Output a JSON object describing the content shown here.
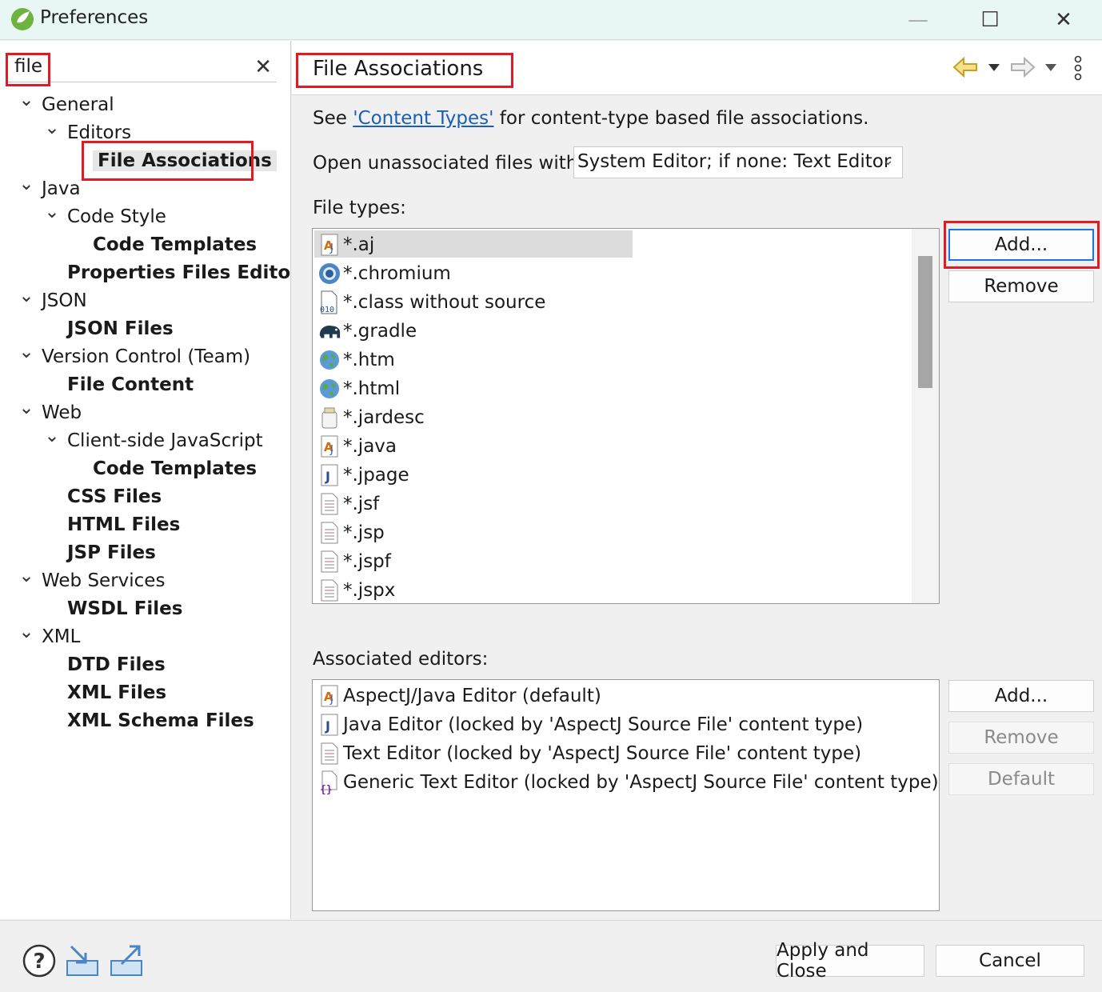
{
  "window": {
    "title": "Preferences",
    "minimize": "—",
    "maximize": "☐",
    "close": "✕"
  },
  "filter": {
    "value": "file",
    "clear_icon": "✕"
  },
  "tree": [
    {
      "label": "General",
      "chevron": "⌄"
    },
    {
      "label": "Editors",
      "chevron": "⌄"
    },
    {
      "label": "File Associations"
    },
    {
      "label": "Java",
      "chevron": "⌄"
    },
    {
      "label": "Code Style",
      "chevron": "⌄"
    },
    {
      "label": "Code Templates"
    },
    {
      "label": "Properties Files Editor"
    },
    {
      "label": "JSON",
      "chevron": "⌄"
    },
    {
      "label": "JSON Files"
    },
    {
      "label": "Version Control (Team)",
      "chevron": "⌄"
    },
    {
      "label": "File Content"
    },
    {
      "label": "Web",
      "chevron": "⌄"
    },
    {
      "label": "Client-side JavaScript",
      "chevron": "⌄"
    },
    {
      "label": "Code Templates"
    },
    {
      "label": "CSS Files"
    },
    {
      "label": "HTML Files"
    },
    {
      "label": "JSP Files"
    },
    {
      "label": "Web Services",
      "chevron": "⌄"
    },
    {
      "label": "WSDL Files"
    },
    {
      "label": "XML",
      "chevron": "⌄"
    },
    {
      "label": "DTD Files"
    },
    {
      "label": "XML Files"
    },
    {
      "label": "XML Schema Files"
    }
  ],
  "page": {
    "title": "File Associations",
    "desc_prefix": "See ",
    "desc_link": "'Content Types'",
    "desc_suffix": " for content-type based file associations.",
    "open_label": "Open unassociated files with:",
    "open_value": "System Editor; if none: Text Editor",
    "file_types_label": "File types:",
    "associated_label": "Associated editors:"
  },
  "file_types": [
    {
      "name": "*.aj",
      "icon": "aspectj-icon"
    },
    {
      "name": "*.chromium",
      "icon": "chromium-icon"
    },
    {
      "name": "*.class without source",
      "icon": "class-file-icon"
    },
    {
      "name": "*.gradle",
      "icon": "gradle-elephant-icon"
    },
    {
      "name": "*.htm",
      "icon": "globe-icon"
    },
    {
      "name": "*.html",
      "icon": "globe-icon"
    },
    {
      "name": "*.jardesc",
      "icon": "jar-icon"
    },
    {
      "name": "*.java",
      "icon": "aspectj-icon"
    },
    {
      "name": "*.jpage",
      "icon": "java-page-icon"
    },
    {
      "name": "*.jsf",
      "icon": "text-file-icon"
    },
    {
      "name": "*.jsp",
      "icon": "text-file-icon"
    },
    {
      "name": "*.jspf",
      "icon": "text-file-icon"
    },
    {
      "name": "*.jspx",
      "icon": "text-file-icon"
    }
  ],
  "editors": [
    {
      "name": "AspectJ/Java Editor (default)",
      "icon": "aspectj-icon"
    },
    {
      "name": "Java Editor (locked by 'AspectJ Source File' content type)",
      "icon": "java-page-icon"
    },
    {
      "name": "Text Editor (locked by 'AspectJ Source File' content type)",
      "icon": "text-file-icon"
    },
    {
      "name": "Generic Text Editor (locked by 'AspectJ Source File' content type)",
      "icon": "generic-editor-icon"
    }
  ],
  "buttons": {
    "types_add": "Add...",
    "types_remove": "Remove",
    "editors_add": "Add...",
    "editors_remove": "Remove",
    "editors_default": "Default",
    "apply_close": "Apply and Close",
    "cancel": "Cancel"
  },
  "colors": {
    "highlight": "#e01b24",
    "link": "#1a5fb4",
    "selection": "#dcdcdc"
  }
}
